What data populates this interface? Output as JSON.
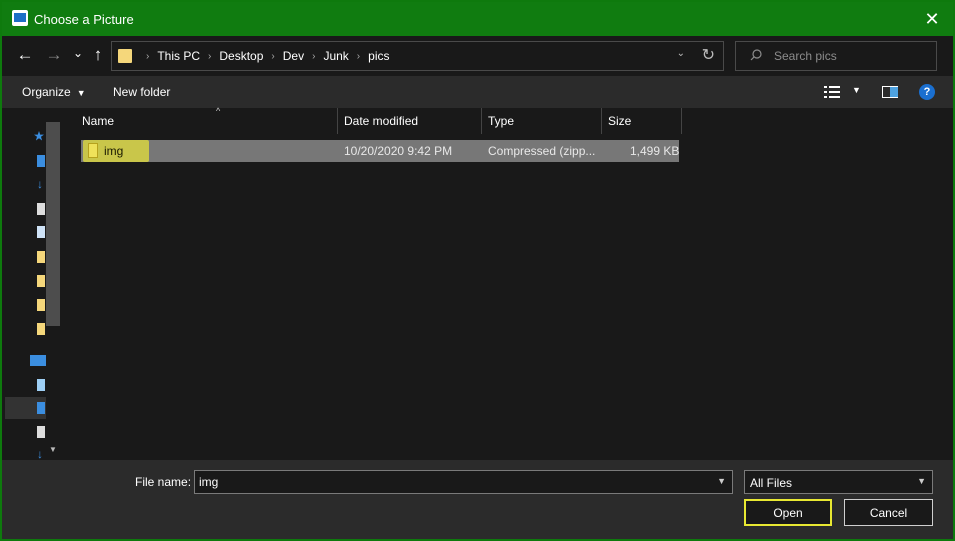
{
  "window": {
    "title": "Choose a Picture",
    "close_glyph": "✕",
    "accent": "#107c10"
  },
  "nav": {
    "back_glyph": "←",
    "forward_glyph": "→",
    "recent_glyph": "⌄",
    "up_glyph": "↑",
    "breadcrumb": [
      "This PC",
      "Desktop",
      "Dev",
      "Junk",
      "pics"
    ],
    "refresh_glyph": "↻"
  },
  "search": {
    "placeholder": "Search pics"
  },
  "toolbar": {
    "organize_label": "Organize",
    "new_folder_label": "New folder",
    "help_glyph": "?"
  },
  "columns": {
    "name": "Name",
    "date": "Date modified",
    "type": "Type",
    "size": "Size"
  },
  "files": [
    {
      "name": "img",
      "date_modified": "10/20/2020 9:42 PM",
      "type": "Compressed (zipp...",
      "size": "1,499 KB",
      "icon": "zip-folder-icon",
      "highlight_color": "#c9c64a"
    }
  ],
  "footer": {
    "file_name_label": "File name:",
    "file_name_value": "img",
    "file_type_value": "All Files",
    "open_label": "Open",
    "cancel_label": "Cancel",
    "focus_color": "#e8e832"
  }
}
